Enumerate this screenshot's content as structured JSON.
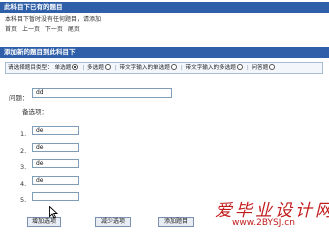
{
  "existing_section": {
    "title": "此科目下已有的题目",
    "empty_notice": "本科目下暂时没有任何题目，请添加",
    "nav": [
      "首页",
      "上一页",
      "下一页",
      "尾页"
    ]
  },
  "add_section": {
    "title": "添加新的题目到此科目下",
    "type_label": "请选择题目类型：",
    "types": [
      {
        "label": "单选题",
        "checked": true
      },
      {
        "label": "多选题",
        "checked": false
      },
      {
        "label": "带文字输入的单选题",
        "checked": false
      },
      {
        "label": "带文字输入的多选题",
        "checked": false
      },
      {
        "label": "问答题",
        "checked": false
      }
    ],
    "question_label": "问题：",
    "question_value": "dd",
    "options_label": "备选项：",
    "options": [
      {
        "num": "1.",
        "value": "de"
      },
      {
        "num": "2.",
        "value": "de"
      },
      {
        "num": "3.",
        "value": "de"
      },
      {
        "num": "4.",
        "value": "de"
      },
      {
        "num": "5.",
        "value": ""
      }
    ],
    "buttons": {
      "add_option": "增加选项",
      "remove_option": "减少选项",
      "add_question": "添加题目"
    }
  },
  "watermark": {
    "title": "爱毕业设计网",
    "url": "www.2BYSJ.cn"
  },
  "colors": {
    "header_bar": "#2f5fa8",
    "watermark": "#c21c1c"
  }
}
